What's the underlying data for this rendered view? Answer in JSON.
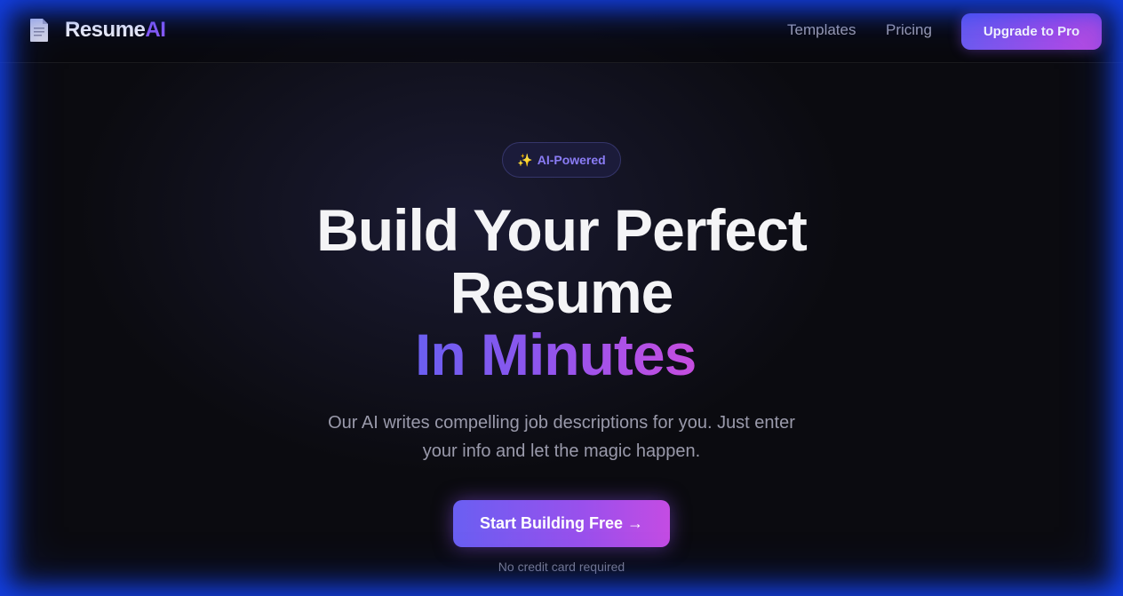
{
  "header": {
    "brand_primary": "Resume",
    "brand_accent": "AI",
    "logo_icon": "document-icon",
    "nav": [
      {
        "label": "Templates"
      },
      {
        "label": "Pricing"
      }
    ],
    "upgrade_label": "Upgrade to Pro"
  },
  "hero": {
    "badge_icon": "✨",
    "badge_label": "AI-Powered",
    "title_line1": "Build Your Perfect",
    "title_line2": "Resume",
    "title_line3": "In Minutes",
    "subtitle_line1": "Our AI writes compelling job descriptions for you. Just enter",
    "subtitle_line2": "your info and let the magic happen.",
    "cta_label": "Start Building Free →",
    "note": "No credit card required"
  },
  "colors": {
    "accent_start": "#6a5ff0",
    "accent_end": "#c64ddf",
    "background": "#0b0b10",
    "frame_glow": "#1446ff"
  }
}
